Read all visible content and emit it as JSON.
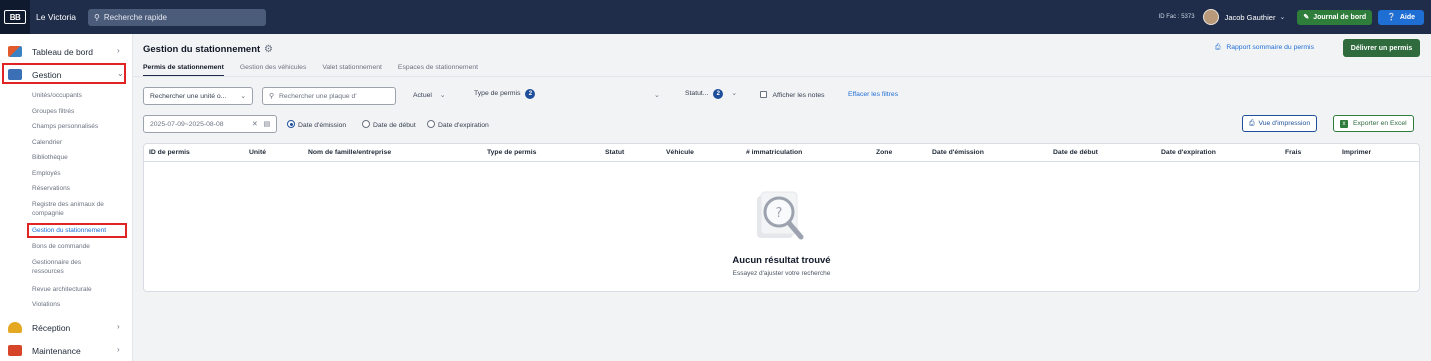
{
  "topbar": {
    "logo_text": "BB",
    "app_name": "Le Victoria",
    "search_placeholder": "Recherche rapide",
    "id_fac": "ID Fac : 5373",
    "user_name": "Jacob Gauthier",
    "journal_button": "Journal de bord",
    "help_button": "Aide"
  },
  "sidebar": {
    "tableau": "Tableau de bord",
    "gestion": "Gestion",
    "sub_items": [
      "Unités/occupants",
      "Groupes filtrés",
      "Champs personnalisés",
      "Calendrier",
      "Bibliothèque",
      "Employés",
      "Réservations",
      "Registre des animaux de",
      "compagnie",
      "Gestion du stationnement",
      "Bons de commande",
      "Gestionnaire des",
      "ressources",
      "Revue architecturale",
      "Violations"
    ],
    "reception": "Réception",
    "maintenance": "Maintenance"
  },
  "page": {
    "title": "Gestion du stationnement",
    "report_link": "Rapport sommaire du permis",
    "deliver_button": "Délivrer un permis",
    "tabs": [
      "Permis de stationnement",
      "Gestion des véhicules",
      "Valet stationnement",
      "Espaces de stationnement"
    ]
  },
  "filters": {
    "unit_select": "Rechercher une unité o...",
    "plate_placeholder": "Rechercher une plaque d'",
    "current": "Actuel",
    "permit_type": "Type de permis",
    "permit_type_count": "2",
    "status": "Statut...",
    "status_count": "2",
    "show_notes": "Afficher les notes",
    "clear_filters": "Effacer les filtres",
    "date_range": "2025-07-09~2025-08-08",
    "radio_issue": "Date d'émission",
    "radio_start": "Date de début",
    "radio_expiry": "Date d'expiration",
    "print_view": "Vue d'impression",
    "export_excel": "Exporter en Excel"
  },
  "table": {
    "columns": [
      "ID de permis",
      "Unité",
      "Nom de famille/entreprise",
      "Type de permis",
      "Statut",
      "Véhicule",
      "# immatriculation",
      "Zone",
      "Date d'émission",
      "Date de début",
      "Date d'expiration",
      "Frais",
      "Imprimer"
    ],
    "empty_title": "Aucun résultat trouvé",
    "empty_subtitle": "Essayez d'ajuster votre recherche"
  },
  "colors": {
    "topbar": "#1f2d4a",
    "green": "#2f7d3a",
    "blue": "#1f6ed4",
    "highlight": "#e02424"
  }
}
